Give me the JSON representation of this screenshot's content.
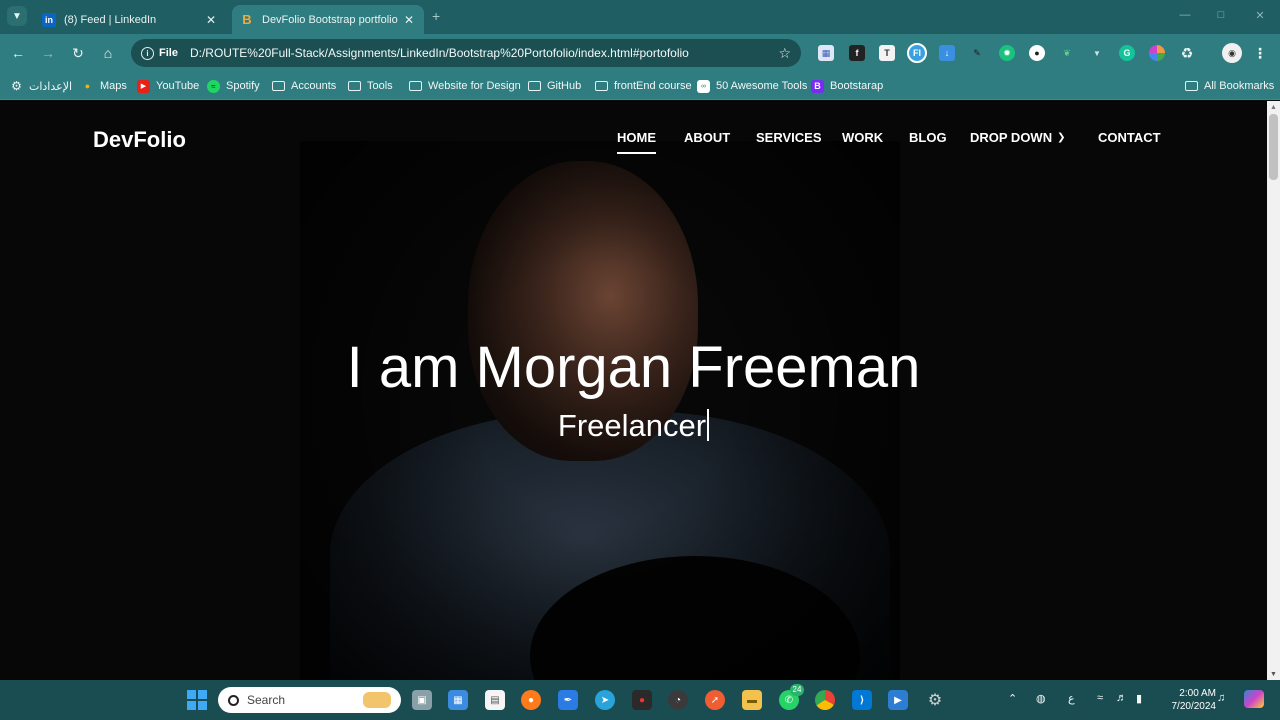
{
  "browser": {
    "tabs": [
      {
        "title": "(8) Feed | LinkedIn",
        "favicon": "linkedin-icon",
        "active": false
      },
      {
        "title": "DevFolio Bootstrap portfolio",
        "favicon": "bootstrap-icon",
        "active": true
      }
    ],
    "address": {
      "scheme_label": "File",
      "url": "D:/ROUTE%20Full-Stack/Assignments/LinkedIn/Bootstrap%20Portofolio/index.html#portofolio"
    },
    "bookmarks": [
      {
        "label": "الإعدادات",
        "icon": "gear-icon"
      },
      {
        "label": "Maps",
        "icon": "maps-icon"
      },
      {
        "label": "YouTube",
        "icon": "youtube-icon"
      },
      {
        "label": "Spotify",
        "icon": "spotify-icon"
      },
      {
        "label": "Accounts",
        "icon": "folder-icon"
      },
      {
        "label": "Tools",
        "icon": "folder-icon"
      },
      {
        "label": "Website for Design",
        "icon": "folder-icon"
      },
      {
        "label": "GitHub",
        "icon": "folder-icon"
      },
      {
        "label": "frontEnd course",
        "icon": "folder-icon"
      },
      {
        "label": "50 Awesome Tools",
        "icon": "tools-icon"
      },
      {
        "label": "Bootstarap",
        "icon": "bootstrap-icon"
      }
    ],
    "all_bookmarks_label": "All Bookmarks"
  },
  "site": {
    "brand": "DevFolio",
    "nav": [
      {
        "label": "HOME",
        "active": true
      },
      {
        "label": "ABOUT",
        "active": false
      },
      {
        "label": "SERVICES",
        "active": false
      },
      {
        "label": "WORK",
        "active": false
      },
      {
        "label": "BLOG",
        "active": false
      },
      {
        "label": "DROP DOWN",
        "active": false,
        "dropdown": true
      },
      {
        "label": "CONTACT",
        "active": false
      }
    ],
    "hero": {
      "title": "I am Morgan Freeman",
      "subtitle": "Freelancer"
    }
  },
  "taskbar": {
    "search_label": "Search",
    "whatsapp_badge": "24",
    "ime_label": "ع",
    "time": "2:00 AM",
    "date": "7/20/2024"
  },
  "colors": {
    "chrome": "#2f7d80",
    "tabbar": "#1f5f63",
    "taskbar": "#1a4d52",
    "page_bg": "#070707"
  }
}
